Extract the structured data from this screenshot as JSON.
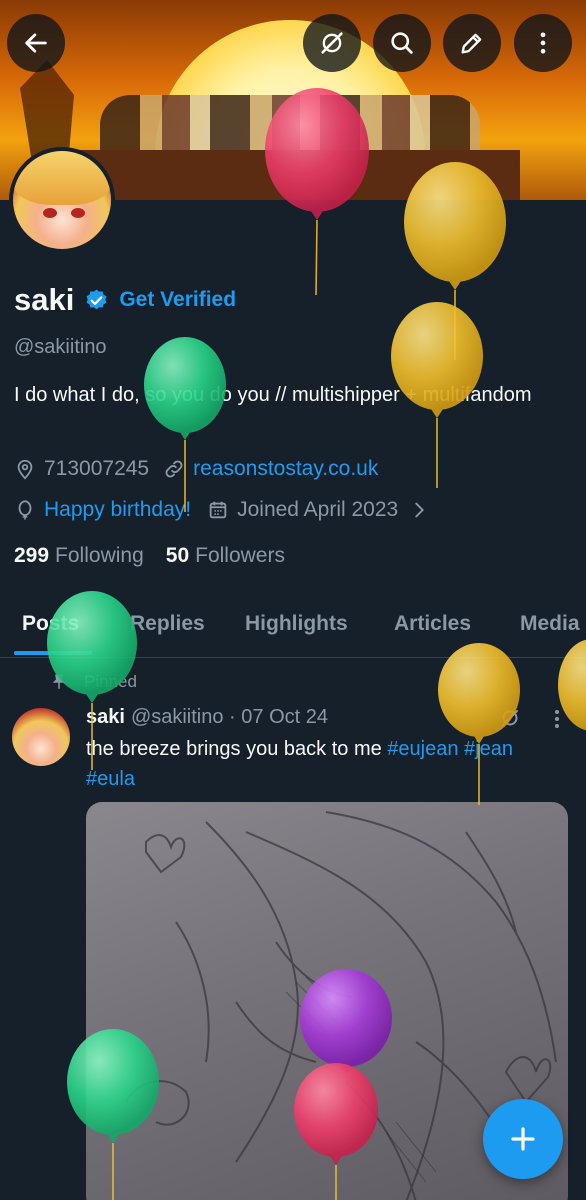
{
  "header": {
    "back_icon": "arrow-left-icon",
    "actions": [
      "no-sync-icon",
      "search-icon",
      "edit-icon",
      "more-vertical-icon"
    ]
  },
  "profile": {
    "name": "saki",
    "get_verified": "Get Verified",
    "handle": "@sakiitino",
    "bio": "I do what I do, so you do you // multishipper + multifandom",
    "location": "713007245",
    "website": "reasonstostay.co.uk",
    "birthday": "Happy birthday!",
    "joined": "Joined April 2023",
    "following_count": "299",
    "following_label": "Following",
    "followers_count": "50",
    "followers_label": "Followers"
  },
  "tabs": [
    "Posts",
    "Replies",
    "Highlights",
    "Articles",
    "Media"
  ],
  "active_tab": "Posts",
  "post": {
    "pinned_label": "Pinned",
    "author": "saki",
    "meta": "@sakiitino · 07 Oct 24",
    "text": "the breeze brings you back to me",
    "hashtags": [
      "#eujean",
      "#jean",
      "#eula"
    ]
  },
  "colors": {
    "background": "#15202b",
    "accent": "#1d9bf0",
    "text": "#f7f9f9",
    "muted": "#8b98a5",
    "balloon_red": "#ef3f6b",
    "balloon_yellow": "#f2c12e",
    "balloon_green": "#2bd68a",
    "balloon_purple": "#a63ad8"
  }
}
